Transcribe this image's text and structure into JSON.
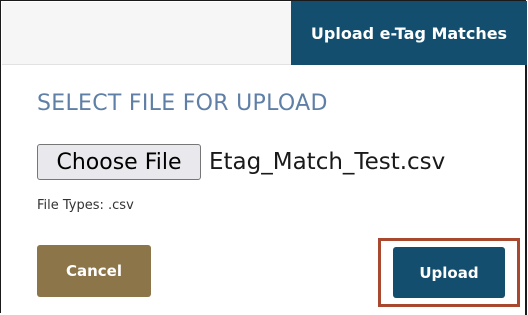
{
  "tabs": {
    "active_label": "Upload e-Tag Matches"
  },
  "section": {
    "heading": "SELECT FILE FOR UPLOAD"
  },
  "file_input": {
    "button_label": "Choose File",
    "selected_file": "Etag_Match_Test.csv",
    "file_types_note": "File Types: .csv"
  },
  "actions": {
    "cancel_label": "Cancel",
    "upload_label": "Upload"
  },
  "colors": {
    "primary": "#134e6e",
    "cancel": "#8c7548",
    "heading": "#5f7fa6",
    "highlight": "#a8482e"
  }
}
